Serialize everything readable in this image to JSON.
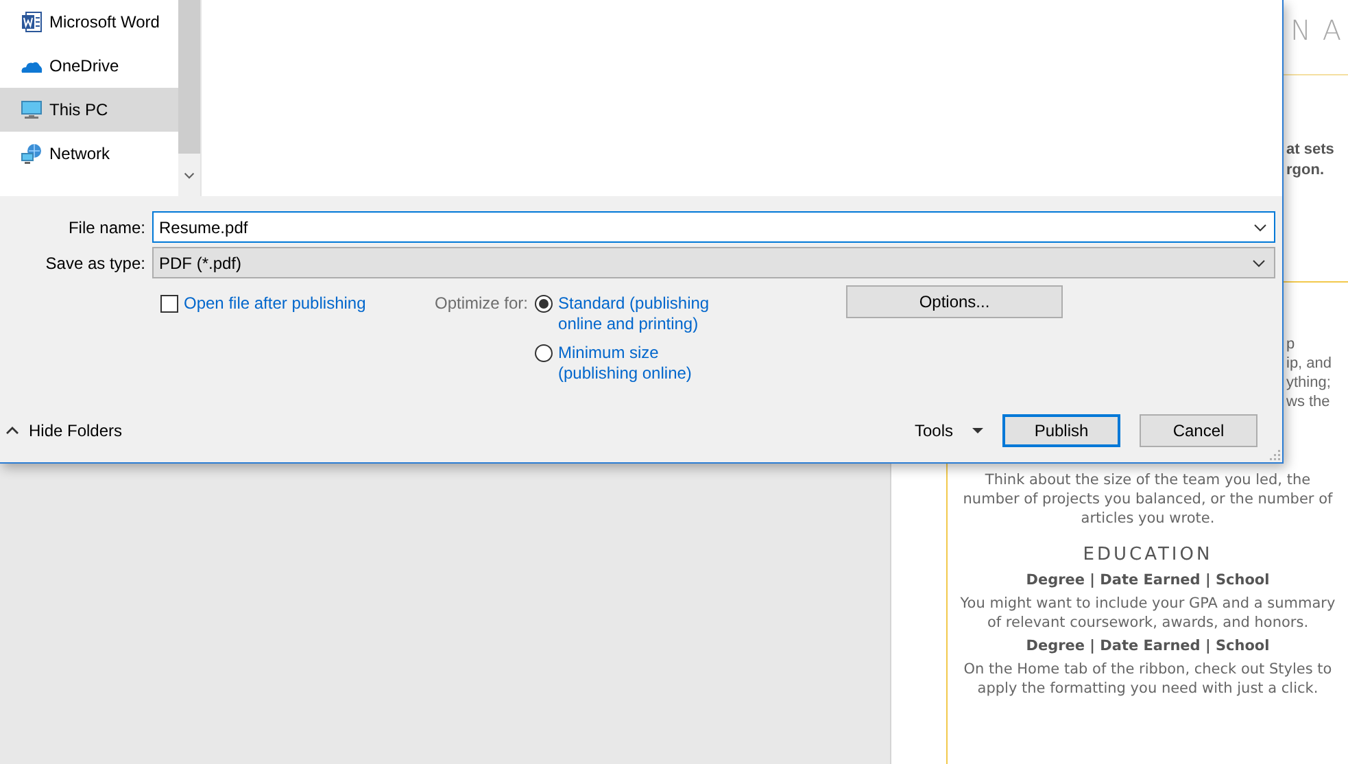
{
  "dialog": {
    "nav_items": [
      {
        "label": "Microsoft Word",
        "selected": false
      },
      {
        "label": "OneDrive",
        "selected": false
      },
      {
        "label": "This PC",
        "selected": true
      },
      {
        "label": "Network",
        "selected": false
      }
    ],
    "file_name": {
      "label": "File name:",
      "value": "Resume.pdf"
    },
    "save_as_type": {
      "label": "Save as type:",
      "value": "PDF (*.pdf)"
    },
    "open_after": {
      "label": "Open file after publishing",
      "checked": false
    },
    "optimize": {
      "label": "Optimize for:",
      "options": [
        {
          "label": "Standard (publishing online and printing)",
          "selected": true
        },
        {
          "label": "Minimum size (publishing online)",
          "selected": false
        }
      ]
    },
    "options_button": "Options...",
    "hide_folders": "Hide Folders",
    "tools": "Tools",
    "publish": "Publish",
    "cancel": "Cancel"
  },
  "document": {
    "top_fragments": [
      "N A"
    ],
    "bold_fragments": [
      "at sets",
      "rgon."
    ],
    "text_fragments": [
      "p",
      "ip, and",
      "ything;",
      "ws the"
    ],
    "experience_text": "Think about the size of the team you led, the number of projects you balanced, or the number of articles you wrote.",
    "education_heading": "EDUCATION",
    "entries": [
      {
        "title": "Degree | Date Earned | School",
        "text": "You might want to include your GPA and a summary of relevant coursework, awards, and honors."
      },
      {
        "title": "Degree | Date Earned | School",
        "text": "On the Home tab of the ribbon, check out Styles to apply the formatting you need with just a click."
      }
    ]
  }
}
